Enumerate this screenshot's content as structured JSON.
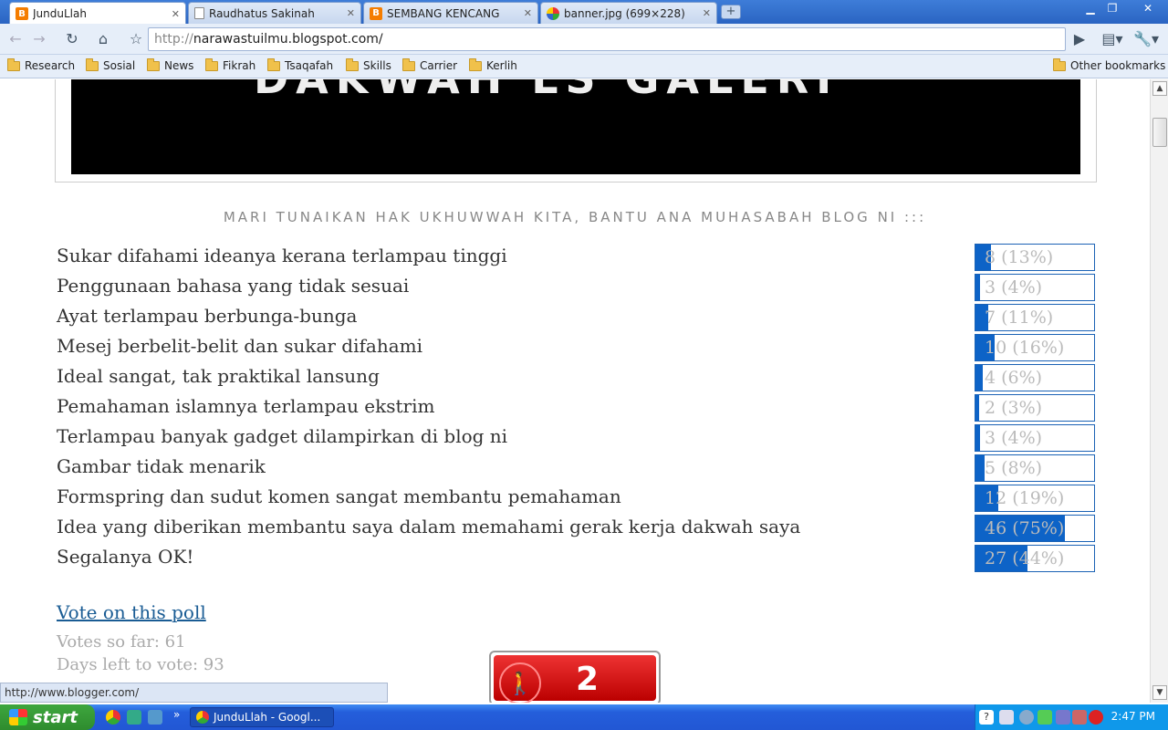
{
  "browser": {
    "tabs": [
      {
        "title": "JunduLlah",
        "favicon": "blogger-icon",
        "active": true
      },
      {
        "title": "Raudhatus Sakinah",
        "favicon": "page-icon",
        "active": false
      },
      {
        "title": "SEMBANG KENCANG",
        "favicon": "blogger-icon",
        "active": false
      },
      {
        "title": "banner.jpg (699×228)",
        "favicon": "picasa-icon",
        "active": false
      }
    ],
    "address_prefix": "http://",
    "address_host": "narawastuilmu.blogspot.com/",
    "bookmarks": [
      "Research",
      "Sosial",
      "News",
      "Fikrah",
      "Tsaqafah",
      "Skills",
      "Carrier",
      "Kerlih"
    ],
    "other_bookmarks": "Other bookmarks",
    "status_url": "http://www.blogger.com/"
  },
  "poll": {
    "title": "MARI TUNAIKAN HAK UKHUWWAH KITA, BANTU ANA MUHASABAH BLOG NI :::",
    "options": [
      {
        "label": "Sukar difahami ideanya kerana terlampau tinggi",
        "count": "8 (13%)",
        "percent": 13
      },
      {
        "label": "Penggunaan bahasa yang tidak sesuai",
        "count": "3 (4%)",
        "percent": 4
      },
      {
        "label": "Ayat terlampau berbunga-bunga",
        "count": "7 (11%)",
        "percent": 11
      },
      {
        "label": "Mesej berbelit-belit dan sukar difahami",
        "count": "10 (16%)",
        "percent": 16
      },
      {
        "label": "Ideal sangat, tak praktikal lansung",
        "count": "4 (6%)",
        "percent": 6
      },
      {
        "label": "Pemahaman islamnya terlampau ekstrim",
        "count": "2 (3%)",
        "percent": 3
      },
      {
        "label": "Terlampau banyak gadget dilampirkan di blog ni",
        "count": "3 (4%)",
        "percent": 4
      },
      {
        "label": "Gambar tidak menarik",
        "count": "5 (8%)",
        "percent": 8
      },
      {
        "label": "Formspring dan sudut komen sangat membantu pemahaman",
        "count": "12 (19%)",
        "percent": 19
      },
      {
        "label": "Idea yang diberikan membantu saya dalam memahami gerak kerja dakwah saya",
        "count": "46 (75%)",
        "percent": 75
      },
      {
        "label": "Segalanya OK!",
        "count": "27 (44%)",
        "percent": 44
      }
    ],
    "vote_link": "Vote on this poll",
    "votes_so_far": "Votes so far: 61",
    "days_left": "Days left to vote: 93"
  },
  "counter_widget": {
    "number": "2"
  },
  "taskbar": {
    "start_label": "start",
    "task_label": "JunduLlah - Googl...",
    "clock": "2:47 PM"
  },
  "colors": {
    "poll_fill": "#0d63c7",
    "poll_border": "#1b62b5",
    "link": "#1a5c94"
  }
}
